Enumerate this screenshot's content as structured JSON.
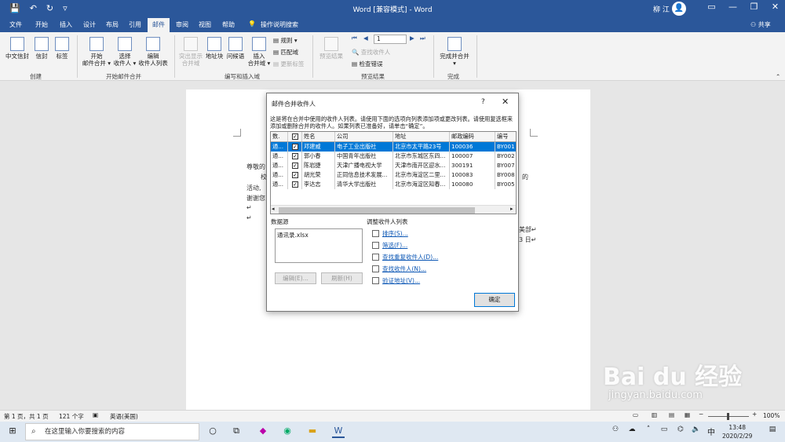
{
  "app": {
    "title": "Word [兼容模式] - Word",
    "user": "柳 江",
    "avatar": "👤",
    "share": "共享",
    "qat": [
      "💾",
      "↶",
      "↻",
      "▿"
    ],
    "winbtns": [
      "▭",
      "—",
      "❐",
      "✕"
    ]
  },
  "tabs": [
    "文件",
    "开始",
    "插入",
    "设计",
    "布局",
    "引用",
    "邮件",
    "审阅",
    "视图",
    "帮助",
    "操作说明搜索"
  ],
  "active_tab": "邮件",
  "ribbon": {
    "create": {
      "label": "创建",
      "buttons": [
        "中文信封",
        "信封",
        "标签"
      ]
    },
    "start": {
      "label": "开始邮件合并",
      "buttons": [
        "开始\n邮件合并 ▾",
        "选择\n收件人 ▾",
        "编辑\n收件人列表"
      ]
    },
    "insert": {
      "label": "编写和插入域",
      "buttons": [
        "突出显示\n合并域",
        "地址块",
        "问候语",
        "插入\n合并域 ▾"
      ],
      "small": [
        "规则 ▾",
        "匹配域",
        "更新标签"
      ]
    },
    "preview": {
      "label": "预览结果",
      "big": "预览结果",
      "record": "1",
      "small": [
        "查找收件人",
        "检查错误"
      ]
    },
    "finish": {
      "label": "完成",
      "big": "完成并合并\n▾"
    }
  },
  "document": {
    "lines": [
      "尊敬的",
      "校",
      "活动,",
      "谢谢您",
      "↵",
      "↵",
      "美部↵",
      "3 日↵",
      "的",
      "的",
      "l"
    ]
  },
  "dialog": {
    "title": "邮件合并收件人",
    "help": "?",
    "close": "✕",
    "description": "这是将在合并中使用的收件人列表。请使用下面的选项向列表添加项或更改列表。请使用复选框来添加或删除合并的收件人。如果列表已准备好，请单击“确定”。",
    "columns": [
      "数.",
      "✓",
      "姓名",
      "公司",
      "地址",
      "邮政编码",
      "编号"
    ],
    "rows": [
      {
        "src": "通...",
        "name": "邓建威",
        "company": "电子工业出版社",
        "address": "北京市太平路23号",
        "zip": "100036",
        "id": "BY001"
      },
      {
        "src": "通...",
        "name": "郭小春",
        "company": "中国青年出版社",
        "address": "北京市东城区东四...",
        "zip": "100007",
        "id": "BY002"
      },
      {
        "src": "通...",
        "name": "陈岩捷",
        "company": "天津广播电视大学",
        "address": "天津市南开区迎水...",
        "zip": "300191",
        "id": "BY007"
      },
      {
        "src": "通...",
        "name": "胡光荣",
        "company": "正同信息技术发展...",
        "address": "北京市海淀区二里...",
        "zip": "100083",
        "id": "BY008"
      },
      {
        "src": "通...",
        "name": "李达志",
        "company": "清华大学出版社",
        "address": "北京市海淀区知春...",
        "zip": "100080",
        "id": "BY005"
      }
    ],
    "datasource_label": "数据源",
    "datasource_file": "通讯录.xlsx",
    "edit_btn": "编辑(E)...",
    "refresh_btn": "刷新(H)",
    "adjust_label": "调整收件人列表",
    "links": [
      "排序(S)...",
      "筛选(F)...",
      "查找重复收件人(D)...",
      "查找收件人(N)...",
      "验证地址(V)..."
    ],
    "ok": "确定"
  },
  "status": {
    "page": "第 1 页，共 1 页",
    "words": "121 个字",
    "lang": "英语(美国)",
    "zoom": "100%",
    "zoom_minus": "−",
    "zoom_plus": "+"
  },
  "taskbar": {
    "search": "在这里输入你要搜索的内容",
    "time": "13:48",
    "date": "2020/2/29",
    "ime": "中"
  },
  "watermark": {
    "main": "Bai du 经验",
    "sub": "jingyan.baidu.com"
  }
}
